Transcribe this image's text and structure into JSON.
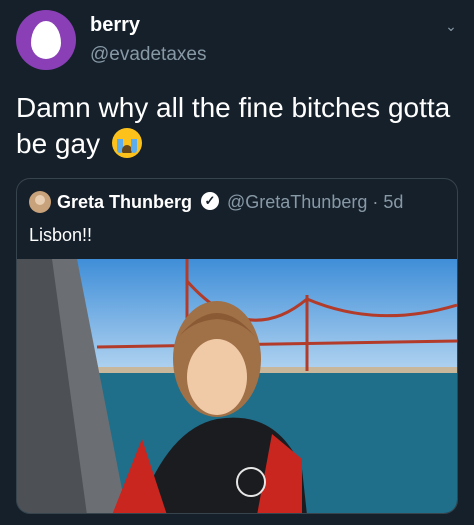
{
  "tweet": {
    "display_name": "berry",
    "handle": "@evadetaxes",
    "text": "Damn why all the fine bitches gotta be gay",
    "emoji": "loudly-crying-face-emoji",
    "menu_icon": "chevron-down-icon"
  },
  "quoted_tweet": {
    "display_name": "Greta Thunberg",
    "verified_icon": "verified-check-icon",
    "handle_and_time": "@GretaThunberg · 5d",
    "text": "Lisbon!!",
    "photo": "photo of a girl on a boat with a red bridge in the background"
  },
  "colors": {
    "background": "#15202b",
    "secondary_text": "#8899a6",
    "border": "#38444d",
    "avatar": "#8a3fb6"
  }
}
